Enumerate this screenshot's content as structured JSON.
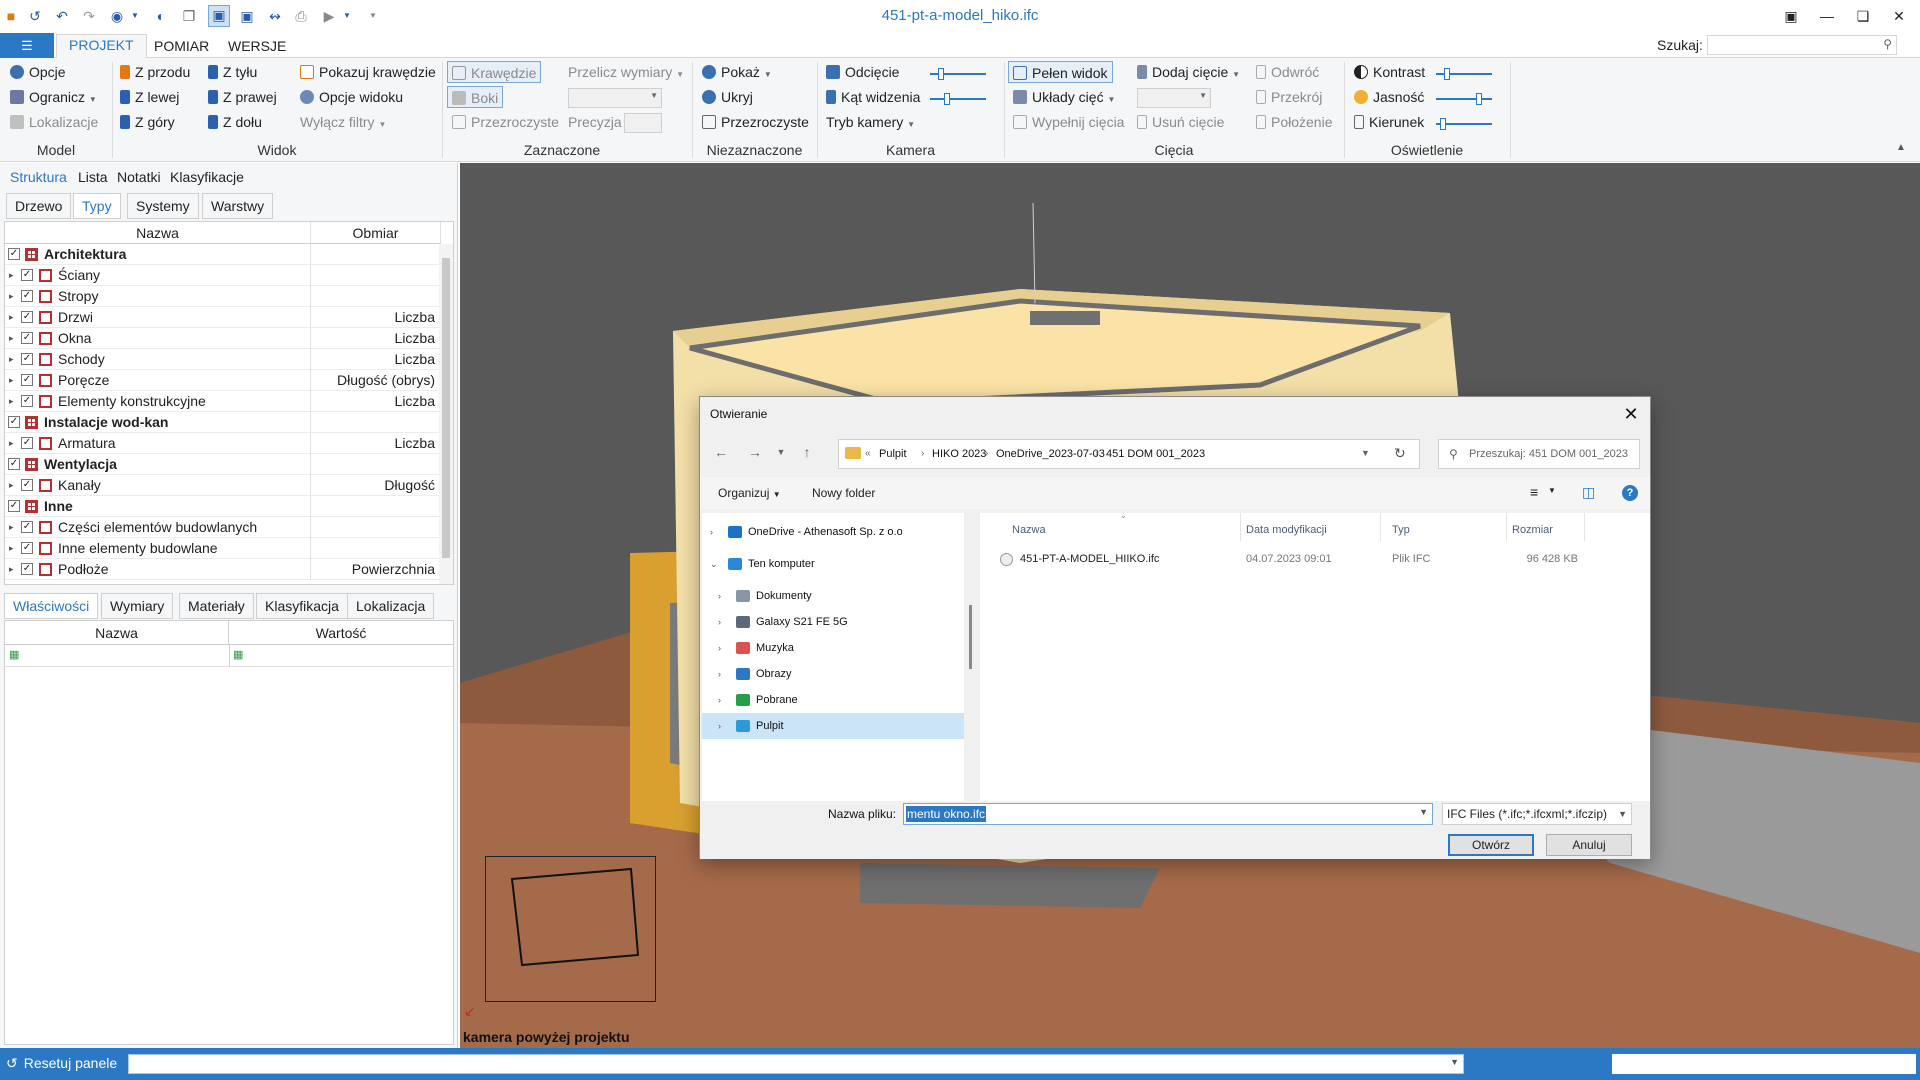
{
  "app": {
    "title": "451-pt-a-model_hiko.ifc",
    "file_tab": "☰",
    "tabs": [
      "PROJEKT",
      "POMIAR",
      "WERSJE"
    ],
    "search_label": "Szukaj:"
  },
  "ribbon": {
    "model": {
      "label": "Model",
      "items": [
        "Opcje",
        "Ogranicz",
        "Lokalizacje"
      ]
    },
    "widok": {
      "label": "Widok",
      "items": [
        "Z przodu",
        "Z lewej",
        "Z góry",
        "Z tyłu",
        "Z prawej",
        "Z dołu",
        "Pokazuj krawędzie",
        "Opcje widoku",
        "Wyłącz filtry"
      ]
    },
    "zaznaczone": {
      "label": "Zaznaczone",
      "items": [
        "Krawędzie",
        "Boki",
        "Przezroczyste",
        "Przelicz wymiary",
        "Precyzja"
      ]
    },
    "niezaznaczone": {
      "label": "Niezaznaczone",
      "items": [
        "Pokaż",
        "Ukryj",
        "Przezroczyste"
      ]
    },
    "kamera": {
      "label": "Kamera",
      "items": [
        "Odcięcie",
        "Kąt widzenia",
        "Tryb kamery"
      ]
    },
    "ciecia": {
      "label": "Cięcia",
      "items": [
        "Pełen widok",
        "Układy cięć",
        "Wypełnij cięcia",
        "Dodaj cięcie",
        "Usuń cięcie",
        "Odwróć",
        "Przekrój",
        "Położenie"
      ]
    },
    "oswietlenie": {
      "label": "Oświetlenie",
      "items": [
        "Kontrast",
        "Jasność",
        "Kierunek"
      ]
    }
  },
  "left_panel": {
    "top_tabs": [
      "Struktura",
      "Lista",
      "Notatki",
      "Klasyfikacje"
    ],
    "sub_tabs": [
      "Drzewo",
      "Typy",
      "Systemy",
      "Warstwy"
    ],
    "tree_columns": [
      "Nazwa",
      "Obmiar"
    ],
    "tree_rows": [
      {
        "name": "Architektura",
        "value": "",
        "group": true
      },
      {
        "name": "Ściany",
        "value": "",
        "group": false
      },
      {
        "name": "Stropy",
        "value": "",
        "group": false
      },
      {
        "name": "Drzwi",
        "value": "Liczba",
        "group": false
      },
      {
        "name": "Okna",
        "value": "Liczba",
        "group": false
      },
      {
        "name": "Schody",
        "value": "Liczba",
        "group": false
      },
      {
        "name": "Poręcze",
        "value": "Długość (obrys)",
        "group": false
      },
      {
        "name": "Elementy konstrukcyjne",
        "value": "Liczba",
        "group": false
      },
      {
        "name": "Instalacje wod-kan",
        "value": "",
        "group": true
      },
      {
        "name": "Armatura",
        "value": "Liczba",
        "group": false
      },
      {
        "name": "Wentylacja",
        "value": "",
        "group": true
      },
      {
        "name": "Kanały",
        "value": "Długość",
        "group": false
      },
      {
        "name": "Inne",
        "value": "",
        "group": true
      },
      {
        "name": "Części elementów budowlanych",
        "value": "",
        "group": false
      },
      {
        "name": "Inne elementy budowlane",
        "value": "",
        "group": false
      },
      {
        "name": "Podłoże",
        "value": "Powierzchnia",
        "group": false
      }
    ],
    "bottom_tabs": [
      "Właściwości",
      "Wymiary",
      "Materiały",
      "Klasyfikacja",
      "Lokalizacja"
    ],
    "props_columns": [
      "Nazwa",
      "Wartość"
    ]
  },
  "viewport": {
    "camera_label": "kamera powyżej projektu"
  },
  "statusbar": {
    "reset_label": "Resetuj panele"
  },
  "dialog": {
    "title": "Otwieranie",
    "breadcrumb": [
      "Pulpit",
      "HIKO 2023",
      "OneDrive_2023-07-03",
      "451 DOM 001_2023"
    ],
    "search_placeholder": "Przeszukaj: 451 DOM 001_2023",
    "organize": "Organizuj",
    "new_folder": "Nowy folder",
    "nav_items": [
      {
        "label": "OneDrive - Athenasoft Sp. z o.o",
        "color": "#1a73c8"
      },
      {
        "label": "Ten komputer",
        "color": "#2b88d8"
      },
      {
        "label": "Dokumenty",
        "color": "#8a96a6"
      },
      {
        "label": "Galaxy S21 FE 5G",
        "color": "#5a6a7a"
      },
      {
        "label": "Muzyka",
        "color": "#d9534f"
      },
      {
        "label": "Obrazy",
        "color": "#2b78c5"
      },
      {
        "label": "Pobrane",
        "color": "#2a9d4a"
      },
      {
        "label": "Pulpit",
        "color": "#2b9ad8"
      }
    ],
    "columns": [
      "Nazwa",
      "Data modyfikacji",
      "Typ",
      "Rozmiar"
    ],
    "files": [
      {
        "name": "451-PT-A-MODEL_HIIKO.ifc",
        "modified": "04.07.2023 09:01",
        "type": "Plik IFC",
        "size": "96 428 KB"
      }
    ],
    "filename_label": "Nazwa pliku:",
    "filename_value": "mentu okno.ifc",
    "filetype": "IFC Files (*.ifc;*.ifcxml;*.ifczip)",
    "open_button": "Otwórz",
    "cancel_button": "Anuluj"
  }
}
